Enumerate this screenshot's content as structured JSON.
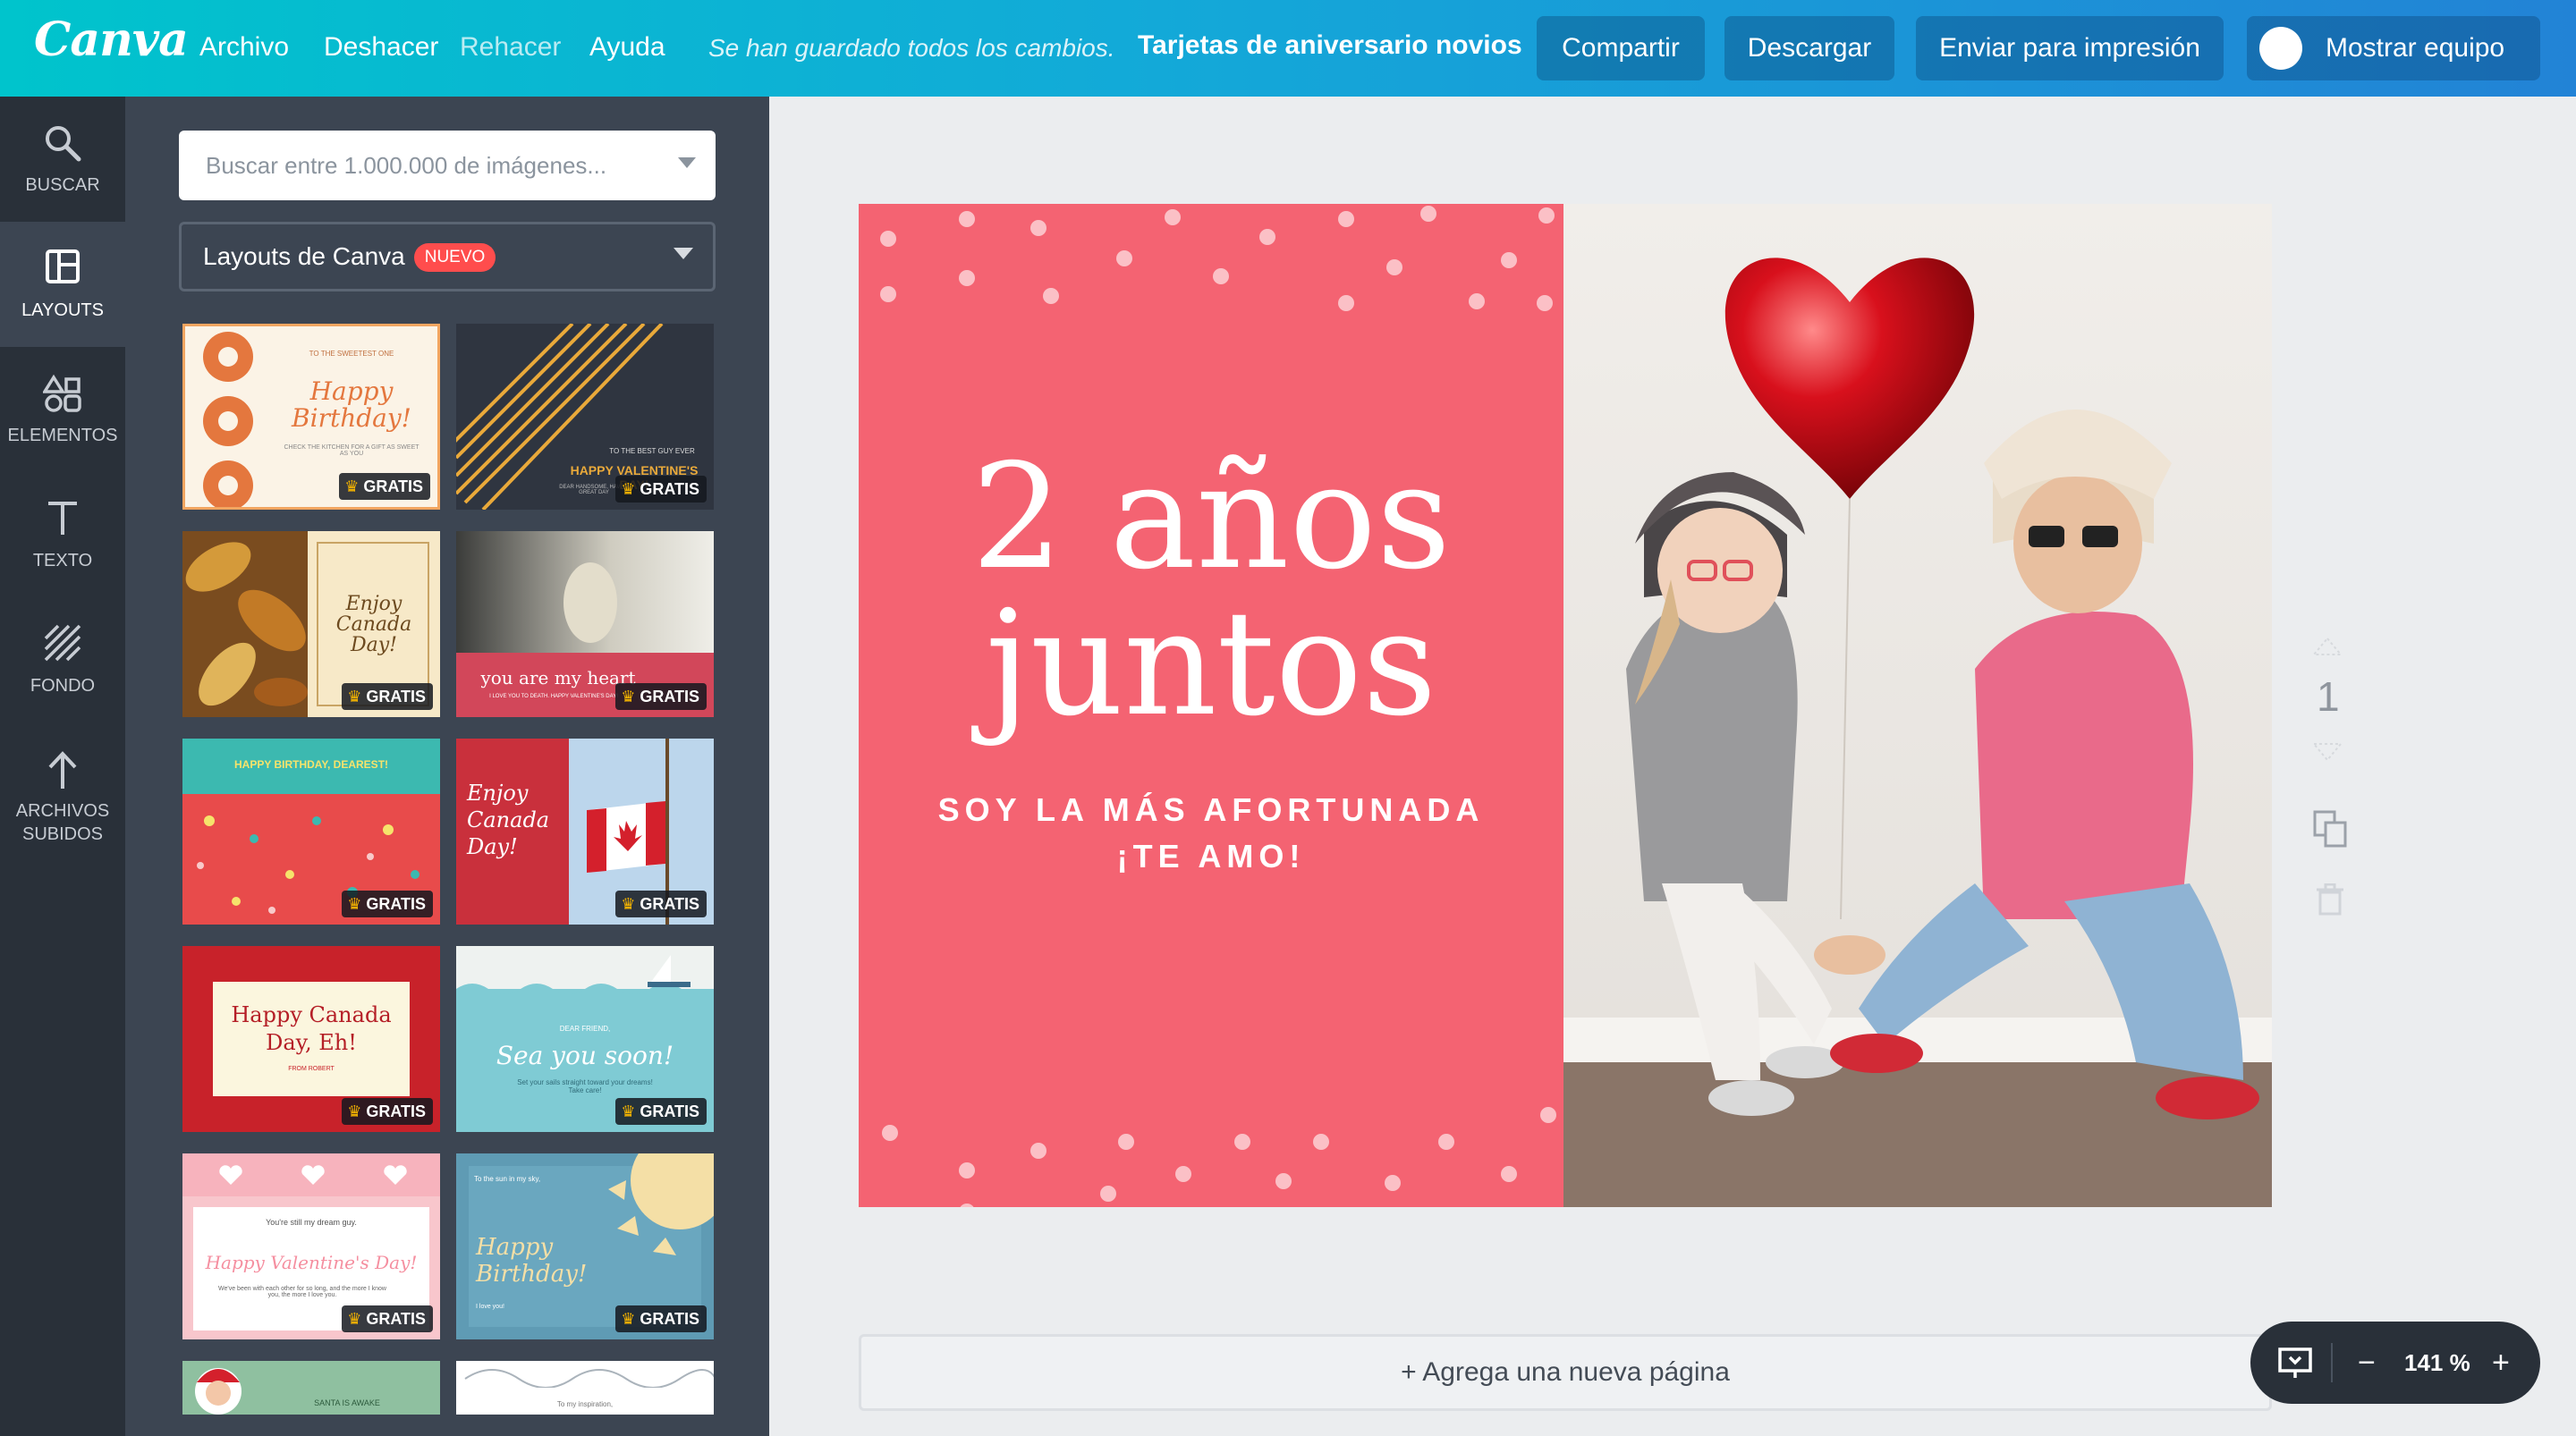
{
  "topbar": {
    "logo": "Canva",
    "menu": [
      "Archivo",
      "Deshacer",
      "Rehacer",
      "Ayuda"
    ],
    "saved_status": "Se han guardado todos los cambios.",
    "doc_title": "Tarjetas de aniversario novios",
    "share_label": "Compartir",
    "download_label": "Descargar",
    "print_label": "Enviar para impresión",
    "team_label": "Mostrar equipo"
  },
  "rail": {
    "items": [
      {
        "label": "BUSCAR",
        "icon": "search-icon"
      },
      {
        "label": "LAYOUTS",
        "icon": "layouts-icon"
      },
      {
        "label": "ELEMENTOS",
        "icon": "elements-icon"
      },
      {
        "label": "TEXTO",
        "icon": "text-icon"
      },
      {
        "label": "FONDO",
        "icon": "background-icon"
      },
      {
        "label": "ARCHIVOS",
        "label2": "SUBIDOS",
        "icon": "upload-icon"
      }
    ]
  },
  "panel": {
    "search_placeholder": "Buscar entre 1.000.000 de imágenes...",
    "layout_select": "Layouts de Canva",
    "new_badge": "NUEVO",
    "free_label": "GRATIS",
    "thumbs": [
      {
        "title": "Happy Birthday!",
        "caption": "TO THE SWEETEST ONE",
        "sub": "CHECK THE KITCHEN FOR A GIFT AS SWEET AS YOU"
      },
      {
        "title": "HAPPY VALENTINE'S DAY!",
        "caption": "TO THE BEST GUY EVER",
        "sub": "DEAR HANDSOME, HAVE A GREAT DAY"
      },
      {
        "title": "Enjoy Canada Day!"
      },
      {
        "title": "you are my heart",
        "sub": "I LOVE YOU TO DEATH. HAPPY VALENTINE'S DAY!"
      },
      {
        "title": "HAPPY BIRTHDAY, DEAREST!"
      },
      {
        "title": "Enjoy Canada Day!"
      },
      {
        "title": "Happy Canada Day, Eh!",
        "sub": "FROM ROBERT"
      },
      {
        "title": "Sea you soon!",
        "caption": "DEAR FRIEND,",
        "sub": "Set your sails straight toward your dreams! Take care!"
      },
      {
        "title": "Happy Valentine's Day!",
        "caption": "You're still my dream guy.",
        "sub": "We've been with each other for so long, and the more I know you, the more I love you."
      },
      {
        "title": "Happy Birthday!",
        "caption": "To the sun in my sky,",
        "sub": "I love you!"
      },
      {
        "title": "SANTA IS AWAKE"
      },
      {
        "title": "To my inspiration,"
      }
    ]
  },
  "design": {
    "line1": "2 años",
    "line2": "juntos",
    "sub1": "SOY LA MÁS AFORTUNADA",
    "sub2": "¡TE AMO!",
    "pink": "#f46372"
  },
  "page_number": "1",
  "add_page": "+ Agrega una nueva página",
  "zoom": {
    "value": "141 %",
    "minus": "−",
    "plus": "+"
  }
}
